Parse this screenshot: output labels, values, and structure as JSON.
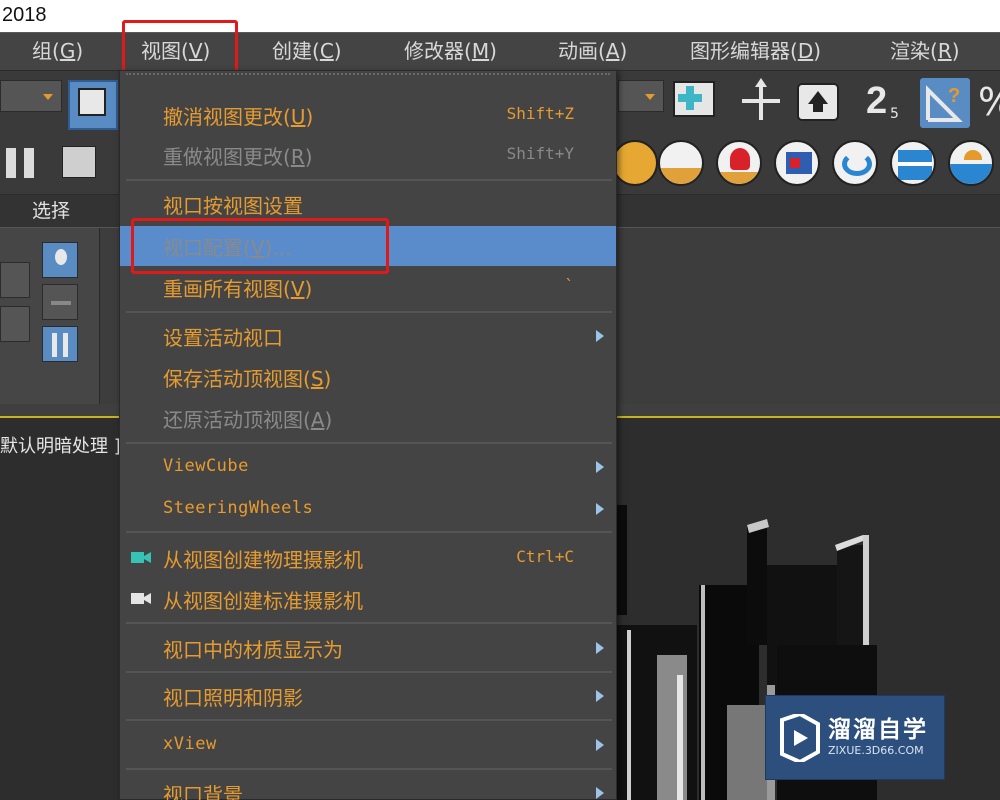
{
  "window": {
    "title_fragment": "2018"
  },
  "menubar": {
    "items": [
      {
        "label": "组(G)",
        "text": "组(",
        "key": "G",
        "end": ")"
      },
      {
        "label": "视图(V)",
        "text": "视图(",
        "key": "V",
        "end": ")"
      },
      {
        "label": "创建(C)",
        "text": "创建(",
        "key": "C",
        "end": ")"
      },
      {
        "label": "修改器(M)",
        "text": "修改器(",
        "key": "M",
        "end": ")"
      },
      {
        "label": "动画(A)",
        "text": "动画(",
        "key": "A",
        "end": ")"
      },
      {
        "label": "图形编辑器(D)",
        "text": "图形编辑器(",
        "key": "D",
        "end": ")"
      },
      {
        "label": "渲染(R)",
        "text": "渲染(",
        "key": "R",
        "end": ")"
      }
    ]
  },
  "toolbar": {
    "snap_label": "2",
    "snap_sub": "5",
    "percent_glyph": "%"
  },
  "ribbon": {
    "panel_tab": "选择"
  },
  "viewport": {
    "label": "默认明暗处理 ]"
  },
  "view_menu": {
    "items": [
      {
        "text": "撤消视图更改(",
        "key": "U",
        "end": ")",
        "shortcut": "Shift+Z"
      },
      {
        "text": "重做视图更改(",
        "key": "R",
        "end": ")",
        "shortcut": "Shift+Y"
      },
      {
        "text": "视口按视图设置"
      },
      {
        "text": "视口配置(",
        "key": "V",
        "end": ")..."
      },
      {
        "text": "重画所有视图(",
        "key": "V",
        "end": ")",
        "shortcut": "`"
      },
      {
        "text": "设置活动视口"
      },
      {
        "text": "保存活动顶视图(",
        "key": "S",
        "end": ")"
      },
      {
        "text": "还原活动顶视图(",
        "key": "A",
        "end": ")"
      },
      {
        "text": "ViewCube"
      },
      {
        "text": "SteeringWheels"
      },
      {
        "text": "从视图创建物理摄影机",
        "shortcut": "Ctrl+C"
      },
      {
        "text": "从视图创建标准摄影机"
      },
      {
        "text": "视口中的材质显示为"
      },
      {
        "text": "视口照明和阴影"
      },
      {
        "text": "xView"
      },
      {
        "text": "视口背景"
      }
    ]
  },
  "watermark": {
    "title": "溜溜自学",
    "subtitle": "ZIXUE.3D66.COM"
  },
  "colors": {
    "menu_text": "#e69b30",
    "menu_disabled": "#8a8a8a",
    "menu_highlight": "#5a8ccc",
    "callout_red": "#e0191b",
    "viewport_border": "#c7b222"
  }
}
